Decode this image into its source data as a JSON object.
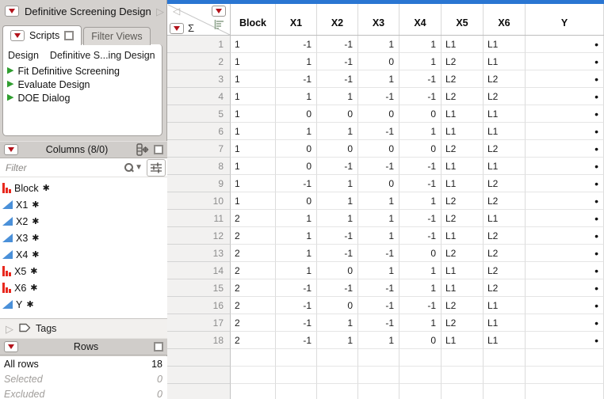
{
  "left_panel": {
    "title": {
      "label": "Definitive Screening Design"
    },
    "scripts_panel": {
      "tabs": [
        {
          "label": "Scripts"
        },
        {
          "label": "Filter Views"
        }
      ],
      "design_row": {
        "label": "Design",
        "value": "Definitive S...ing Design"
      },
      "scripts": [
        "Fit Definitive Screening",
        "Evaluate Design",
        "DOE Dialog"
      ]
    },
    "columns_panel": {
      "header": "Columns (8/0)",
      "filter_placeholder": "Filter",
      "columns": [
        {
          "name": "Block",
          "type": "nominal",
          "star": "✱"
        },
        {
          "name": "X1",
          "type": "continuous",
          "star": "✱"
        },
        {
          "name": "X2",
          "type": "continuous",
          "star": "✱"
        },
        {
          "name": "X3",
          "type": "continuous",
          "star": "✱"
        },
        {
          "name": "X4",
          "type": "continuous",
          "star": "✱"
        },
        {
          "name": "X5",
          "type": "nominal",
          "star": "✱"
        },
        {
          "name": "X6",
          "type": "nominal",
          "star": "✱"
        },
        {
          "name": "Y",
          "type": "continuous",
          "star": "✱"
        }
      ]
    },
    "tags": {
      "label": "Tags"
    },
    "rows_panel": {
      "header": "Rows",
      "stats": [
        {
          "label": "All rows",
          "value": "18",
          "muted": false
        },
        {
          "label": "Selected",
          "value": "0",
          "muted": true
        },
        {
          "label": "Excluded",
          "value": "0",
          "muted": true
        }
      ]
    }
  },
  "table": {
    "columns": [
      "Block",
      "X1",
      "X2",
      "X3",
      "X4",
      "X5",
      "X6",
      "Y"
    ],
    "rows": [
      {
        "n": "1",
        "values": [
          "1",
          "-1",
          "-1",
          "1",
          "1",
          "L1",
          "L1",
          "•"
        ]
      },
      {
        "n": "2",
        "values": [
          "1",
          "1",
          "-1",
          "0",
          "1",
          "L2",
          "L1",
          "•"
        ]
      },
      {
        "n": "3",
        "values": [
          "1",
          "-1",
          "-1",
          "1",
          "-1",
          "L2",
          "L2",
          "•"
        ]
      },
      {
        "n": "4",
        "values": [
          "1",
          "1",
          "1",
          "-1",
          "-1",
          "L2",
          "L2",
          "•"
        ]
      },
      {
        "n": "5",
        "values": [
          "1",
          "0",
          "0",
          "0",
          "0",
          "L1",
          "L1",
          "•"
        ]
      },
      {
        "n": "6",
        "values": [
          "1",
          "1",
          "1",
          "-1",
          "1",
          "L1",
          "L1",
          "•"
        ]
      },
      {
        "n": "7",
        "values": [
          "1",
          "0",
          "0",
          "0",
          "0",
          "L2",
          "L2",
          "•"
        ]
      },
      {
        "n": "8",
        "values": [
          "1",
          "0",
          "-1",
          "-1",
          "-1",
          "L1",
          "L1",
          "•"
        ]
      },
      {
        "n": "9",
        "values": [
          "1",
          "-1",
          "1",
          "0",
          "-1",
          "L1",
          "L2",
          "•"
        ]
      },
      {
        "n": "10",
        "values": [
          "1",
          "0",
          "1",
          "1",
          "1",
          "L2",
          "L2",
          "•"
        ]
      },
      {
        "n": "11",
        "values": [
          "2",
          "1",
          "1",
          "1",
          "-1",
          "L2",
          "L1",
          "•"
        ]
      },
      {
        "n": "12",
        "values": [
          "2",
          "1",
          "-1",
          "1",
          "-1",
          "L1",
          "L2",
          "•"
        ]
      },
      {
        "n": "13",
        "values": [
          "2",
          "1",
          "-1",
          "-1",
          "0",
          "L2",
          "L2",
          "•"
        ]
      },
      {
        "n": "14",
        "values": [
          "2",
          "1",
          "0",
          "1",
          "1",
          "L1",
          "L2",
          "•"
        ]
      },
      {
        "n": "15",
        "values": [
          "2",
          "-1",
          "-1",
          "-1",
          "1",
          "L1",
          "L2",
          "•"
        ]
      },
      {
        "n": "16",
        "values": [
          "2",
          "-1",
          "0",
          "-1",
          "-1",
          "L2",
          "L1",
          "•"
        ]
      },
      {
        "n": "17",
        "values": [
          "2",
          "-1",
          "1",
          "-1",
          "1",
          "L2",
          "L1",
          "•"
        ]
      },
      {
        "n": "18",
        "values": [
          "2",
          "-1",
          "1",
          "1",
          "0",
          "L1",
          "L1",
          "•"
        ]
      }
    ],
    "empty_rows": 3
  }
}
